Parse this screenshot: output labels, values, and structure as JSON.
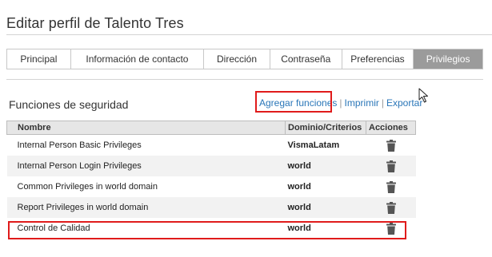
{
  "page": {
    "title": "Editar perfil de Talento Tres"
  },
  "tabs": [
    {
      "label": "Principal"
    },
    {
      "label": "Información de contacto"
    },
    {
      "label": "Dirección"
    },
    {
      "label": "Contraseña"
    },
    {
      "label": "Preferencias"
    },
    {
      "label": "Privilegios",
      "active": true
    }
  ],
  "section": {
    "title": "Funciones de seguridad"
  },
  "actions": {
    "add": "Agregar funciones",
    "print": "Imprimir",
    "export": "Exportar",
    "separator": "|"
  },
  "table": {
    "headers": {
      "name": "Nombre",
      "domain": "Dominio/Criterios",
      "actions": "Acciones"
    },
    "rows": [
      {
        "name": "Internal Person Basic Privileges",
        "domain": "VismaLatam"
      },
      {
        "name": "Internal Person Login Privileges",
        "domain": "world"
      },
      {
        "name": "Common Privileges in world domain",
        "domain": "world"
      },
      {
        "name": "Report Privileges in world domain",
        "domain": "world"
      },
      {
        "name": "Control de Calidad",
        "domain": "world"
      }
    ]
  },
  "icons": {
    "delete": "trash-icon",
    "pointer": "mouse-cursor-icon"
  },
  "colors": {
    "link": "#2a76b8",
    "active_tab": "#9b9b9b",
    "highlight": "#e01b1b",
    "header_bg": "#e6e6e6",
    "stripe": "#f2f2f2"
  }
}
